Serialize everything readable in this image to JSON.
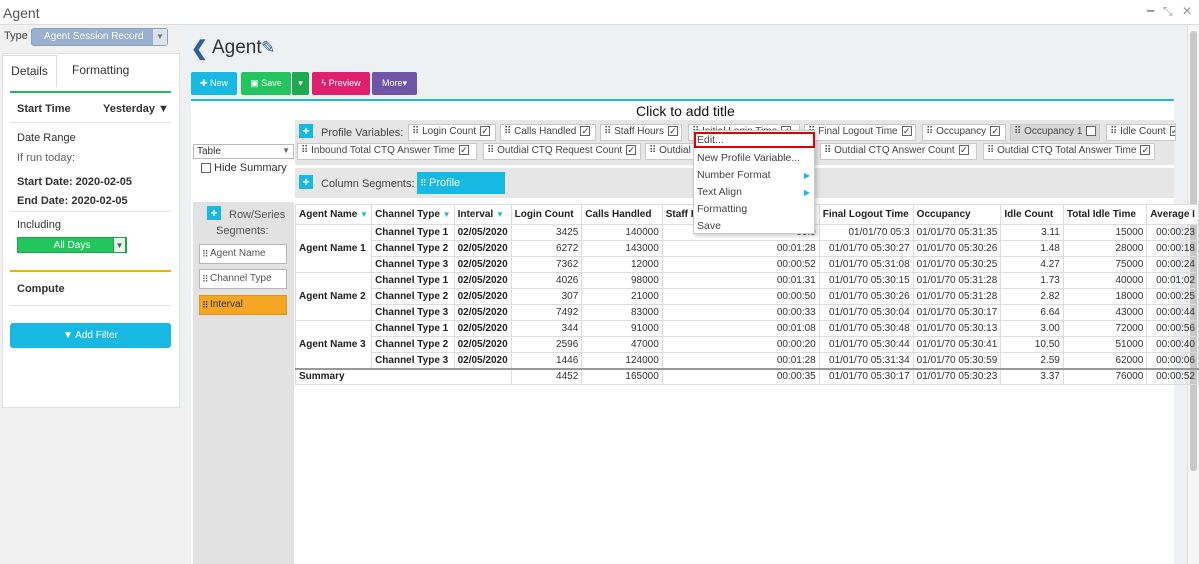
{
  "window": {
    "title": "Agent"
  },
  "left": {
    "type_label": "Type",
    "type_value": "Agent Session Record",
    "tabs": [
      "Details",
      "Formatting"
    ],
    "start_time_label": "Start Time",
    "start_time_value": "Yesterday",
    "date_range_label": "Date Range",
    "if_run_today": "If run today:",
    "start_date": "Start Date: 2020-02-05",
    "end_date": "End Date: 2020-02-05",
    "including_label": "Including",
    "including_value": "All Days",
    "compute_label": "Compute",
    "add_filter": "Add Filter"
  },
  "header": {
    "title": "Agent"
  },
  "toolbar": {
    "new": "New",
    "save": "Save",
    "preview": "Preview",
    "more": "More"
  },
  "report": {
    "title_placeholder": "Click to add title",
    "view_select": "Table",
    "hide_summary": "Hide Summary",
    "profile_label": "Profile Variables:",
    "profile_row1": [
      {
        "label": "Login Count",
        "checked": true
      },
      {
        "label": "Calls Handled",
        "checked": true
      },
      {
        "label": "Staff Hours",
        "checked": true
      },
      {
        "label": "Initial Login Time",
        "checked": true
      },
      {
        "label": "Final Logout Time",
        "checked": true
      },
      {
        "label": "Occupancy",
        "checked": true
      },
      {
        "label": "Occupancy 1",
        "checked": false
      },
      {
        "label": "Idle Count",
        "checked": true
      }
    ],
    "profile_row2": [
      {
        "label": "Inbound Total CTQ Answer Time",
        "checked": true
      },
      {
        "label": "Outdial CTQ Request Count",
        "checked": true
      },
      {
        "label": "Outdial CTQ Request Time",
        "checked": true
      },
      {
        "label": "Outdial CTQ Answer Count",
        "checked": true
      },
      {
        "label": "Outdial CTQ Total Answer Time",
        "checked": true
      }
    ],
    "column_segments_label": "Column Segments:",
    "column_segment_chip": "Profile Variables",
    "row_segments_label1": "Row/Series",
    "row_segments_label2": "Segments:",
    "row_chips": [
      "Agent Name",
      "Channel Type",
      "Interval"
    ]
  },
  "table": {
    "headers": [
      "Agent Name",
      "Channel Type",
      "Interval",
      "Login Count",
      "Calls Handled",
      "Staff Ho",
      "",
      "Final Logout Time",
      "Occupancy",
      "Idle Count",
      "Total Idle Time",
      "Average I"
    ],
    "groups": [
      {
        "agent": "Agent Name 1",
        "rows": [
          [
            "Channel Type 1",
            "02/05/2020",
            "3425",
            "140000",
            "00:0",
            "01/01/70 05:3",
            "01/01/70 05:31:35",
            "3.11",
            "15000",
            "00:00:23"
          ],
          [
            "Channel Type 2",
            "02/05/2020",
            "6272",
            "143000",
            "00:01:28",
            "01/01/70 05:30:27",
            "01/01/70 05:30:26",
            "1.48",
            "28000",
            "00:00:18"
          ],
          [
            "Channel Type 3",
            "02/05/2020",
            "7362",
            "12000",
            "00:00:52",
            "01/01/70 05:31:08",
            "01/01/70 05:30:25",
            "4.27",
            "75000",
            "00:00:24"
          ]
        ]
      },
      {
        "agent": "Agent Name 2",
        "rows": [
          [
            "Channel Type 1",
            "02/05/2020",
            "4026",
            "98000",
            "00:01:31",
            "01/01/70 05:30:15",
            "01/01/70 05:31:28",
            "1.73",
            "40000",
            "00:01:02"
          ],
          [
            "Channel Type 2",
            "02/05/2020",
            "307",
            "21000",
            "00:00:50",
            "01/01/70 05:30:26",
            "01/01/70 05:31:28",
            "2.82",
            "18000",
            "00:00:25"
          ],
          [
            "Channel Type 3",
            "02/05/2020",
            "7492",
            "83000",
            "00:00:33",
            "01/01/70 05:30:04",
            "01/01/70 05:30:17",
            "6.64",
            "43000",
            "00:00:44"
          ]
        ]
      },
      {
        "agent": "Agent Name 3",
        "rows": [
          [
            "Channel Type 1",
            "02/05/2020",
            "344",
            "91000",
            "00:01:08",
            "01/01/70 05:30:48",
            "01/01/70 05:30:13",
            "3.00",
            "72000",
            "00:00:56"
          ],
          [
            "Channel Type 2",
            "02/05/2020",
            "2596",
            "47000",
            "00:00:20",
            "01/01/70 05:30:44",
            "01/01/70 05:30:41",
            "10.50",
            "51000",
            "00:00:40"
          ],
          [
            "Channel Type 3",
            "02/05/2020",
            "1446",
            "124000",
            "00:01:28",
            "01/01/70 05:31:34",
            "01/01/70 05:30:59",
            "2.59",
            "62000",
            "00:00:06"
          ]
        ]
      }
    ],
    "summary": [
      "Summary",
      "4452",
      "165000",
      "00:00:35",
      "01/01/70 05:30:17",
      "01/01/70 05:30:23",
      "3.37",
      "76000",
      "00:00:52"
    ]
  },
  "context_menu": {
    "items": [
      "Edit...",
      "New Profile Variable...",
      "Number Format",
      "Text Align",
      "Formatting",
      "Save"
    ]
  },
  "colors": {
    "accent": "#17b8e2",
    "save": "#22c55e",
    "preview": "#e0206f",
    "more": "#6f55a8",
    "highlight": "#f5a623"
  }
}
